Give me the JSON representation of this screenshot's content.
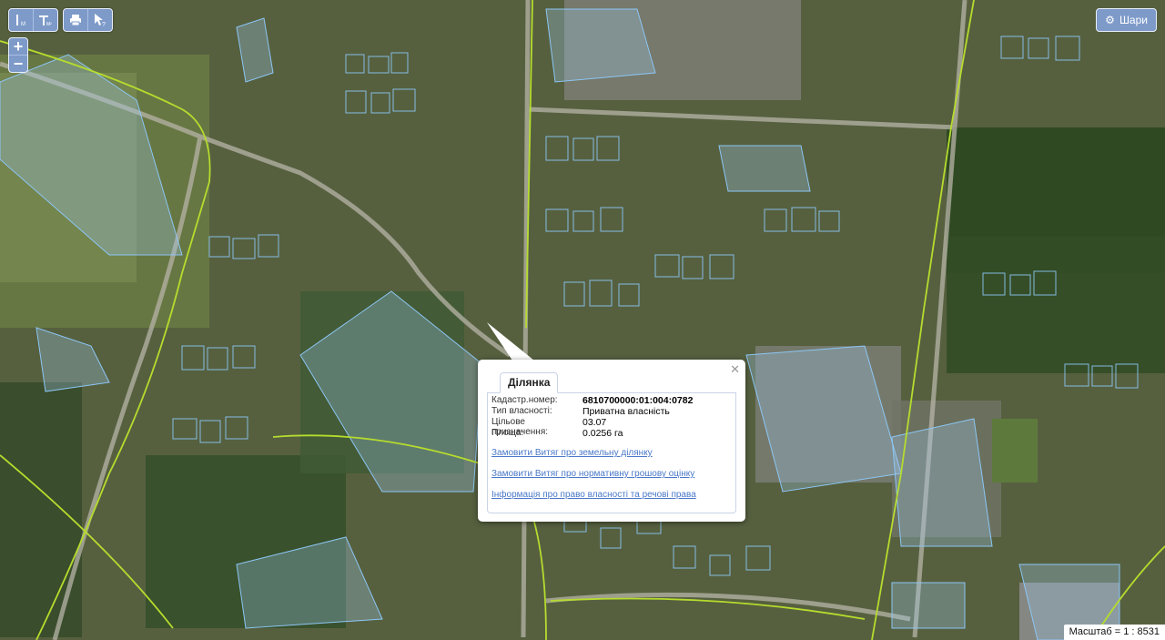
{
  "toolbar": {
    "left_buttons": [
      {
        "name": "measure-length-button",
        "icon": "ruler-icon"
      },
      {
        "name": "measure-area-button",
        "icon": "area-ruler-icon"
      }
    ],
    "right_buttons": [
      {
        "name": "print-button",
        "icon": "printer-icon"
      },
      {
        "name": "identify-button",
        "icon": "cursor-question-icon"
      }
    ]
  },
  "zoom": {
    "in_label": "+",
    "out_label": "−"
  },
  "layers_button": {
    "icon": "gear-icon",
    "label": "Шари"
  },
  "popup": {
    "tab_label": "Ділянка",
    "close_icon": "close-icon",
    "fields": [
      {
        "key": "Кадастр.номер:",
        "value": "6810700000:01:004:0782"
      },
      {
        "key": "Тип власності:",
        "value": "Приватна власність"
      },
      {
        "key": "Цільове призначення:",
        "value": "03.07"
      },
      {
        "key": "Площа:",
        "value": "0.0256 га"
      }
    ],
    "links": [
      "Замовити Витяг про земельну ділянку",
      "Замовити Витяг про нормативну грошову оцінку",
      "Інформація про право власності та речові права"
    ]
  },
  "scale": {
    "label": "Масштаб = 1 : 8531"
  },
  "colors": {
    "parcel_fill": "#9ec9ef",
    "parcel_stroke": "#8cc6f5",
    "boundary_line": "#b6dc2e",
    "control_bg": "#7d9ac9",
    "link": "#4a78c8"
  }
}
